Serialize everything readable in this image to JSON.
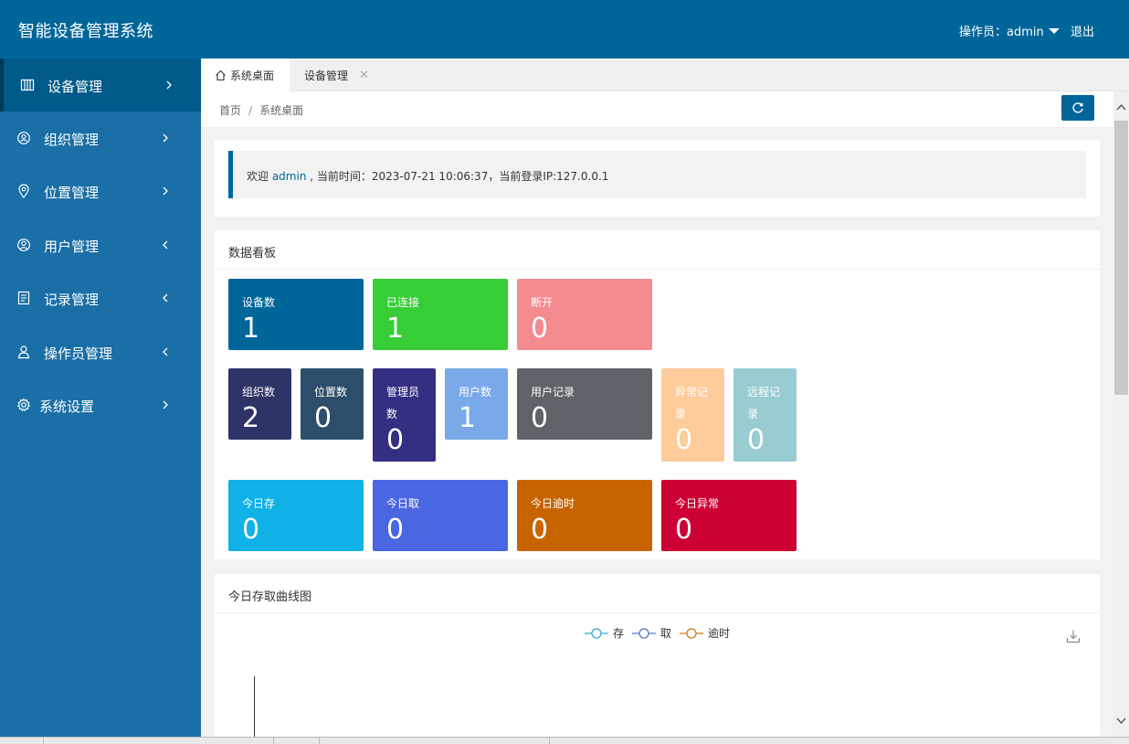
{
  "header": {
    "title": "智能设备管理系统",
    "operator_label": "操作员：admin",
    "logout": "退出"
  },
  "sidebar": {
    "items": [
      {
        "label": "设备管理",
        "icon": "columns-icon"
      },
      {
        "label": "组织管理",
        "icon": "organization-icon"
      },
      {
        "label": "位置管理",
        "icon": "location-pin-icon"
      },
      {
        "label": "用户管理",
        "icon": "user-circle-icon"
      },
      {
        "label": "记录管理",
        "icon": "record-book-icon"
      },
      {
        "label": "操作员管理",
        "icon": "operator-person-icon"
      },
      {
        "label": "系统设置",
        "icon": "gear-icon"
      }
    ]
  },
  "tabs": [
    {
      "label": "系统桌面",
      "icon": "home-icon"
    },
    {
      "label": "设备管理",
      "close": "✕"
    }
  ],
  "breadcrumb": {
    "home": "首页",
    "separator": "/",
    "current": "系统桌面"
  },
  "welcome": {
    "prefix": "欢迎 ",
    "username": "admin",
    "suffix": " , 当前时间：2023-07-21 10:06:37，当前登录IP:127.0.0.1"
  },
  "dashboard": {
    "title": "数据看板",
    "cards": [
      {
        "label": "设备数",
        "value": "1",
        "color": "#006699"
      },
      {
        "label": "已连接",
        "value": "1",
        "color": "#36cd36"
      },
      {
        "label": "断开",
        "value": "0",
        "color": "#f48b8f"
      },
      {
        "label": "组织数",
        "value": "2",
        "color": "#2e3467"
      },
      {
        "label": "位置数",
        "value": "0",
        "color": "#2d4e6a"
      },
      {
        "label": "管理员数",
        "value": "0",
        "color": "#332f82"
      },
      {
        "label": "用户数",
        "value": "1",
        "color": "#7aa9ea"
      },
      {
        "label": "用户记录",
        "value": "0",
        "color": "#5e6369"
      },
      {
        "label": "异常记录",
        "value": "0",
        "color": "#fecb9a"
      },
      {
        "label": "远程记录",
        "value": "0",
        "color": "#99ccd0"
      },
      {
        "label": "今日存",
        "value": "0",
        "color": "#0fb1e6"
      },
      {
        "label": "今日取",
        "value": "0",
        "color": "#4a66e2"
      },
      {
        "label": "今日逾时",
        "value": "0",
        "color": "#c86400"
      },
      {
        "label": "今日异常",
        "value": "0",
        "color": "#cc0033"
      }
    ]
  },
  "chart_section": {
    "title": "今日存取曲线图"
  },
  "chart_data": {
    "type": "line",
    "title": "今日存取曲线图",
    "series": [
      {
        "name": "存",
        "color": "#3aa9dc",
        "values": []
      },
      {
        "name": "取",
        "color": "#5b6fc7",
        "values": []
      },
      {
        "name": "逾时",
        "color": "#d4791b",
        "values": []
      }
    ],
    "legend_position": "top-center"
  }
}
